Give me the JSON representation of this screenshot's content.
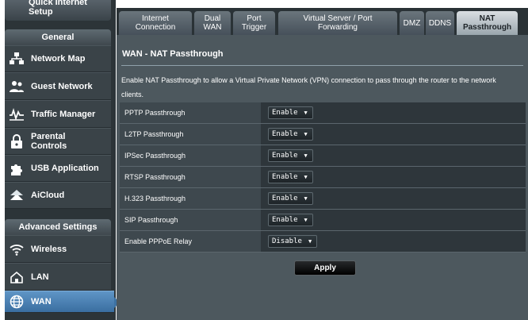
{
  "sidebar": {
    "quick_setup": "Quick Internet Setup",
    "general_header": "General",
    "general_items": [
      {
        "label": "Network Map",
        "icon": "network-map-icon"
      },
      {
        "label": "Guest Network",
        "icon": "guest-network-icon"
      },
      {
        "label": "Traffic Manager",
        "icon": "traffic-manager-icon"
      },
      {
        "label": "Parental Controls",
        "icon": "parental-controls-icon"
      },
      {
        "label": "USB Application",
        "icon": "usb-application-icon"
      },
      {
        "label": "AiCloud",
        "icon": "aicloud-icon"
      }
    ],
    "advanced_header": "Advanced Settings",
    "advanced_items": [
      {
        "label": "Wireless",
        "icon": "wireless-icon"
      },
      {
        "label": "LAN",
        "icon": "lan-icon"
      },
      {
        "label": "WAN",
        "icon": "wan-icon",
        "active": true
      }
    ]
  },
  "tabs": [
    {
      "label": "Internet\nConnection"
    },
    {
      "label": "Dual\nWAN"
    },
    {
      "label": "Port\nTrigger"
    },
    {
      "label": "Virtual Server / Port\nForwarding"
    },
    {
      "label": "DMZ"
    },
    {
      "label": "DDNS"
    },
    {
      "label": "NAT\nPassthrough",
      "active": true
    }
  ],
  "panel": {
    "title": "WAN - NAT Passthrough",
    "description": "Enable NAT Passthrough to allow a Virtual Private Network (VPN) connection to pass through the router to the network clients."
  },
  "settings": [
    {
      "label": "PPTP Passthrough",
      "value": "Enable"
    },
    {
      "label": "L2TP Passthrough",
      "value": "Enable"
    },
    {
      "label": "IPSec Passthrough",
      "value": "Enable"
    },
    {
      "label": "RTSP Passthrough",
      "value": "Enable"
    },
    {
      "label": "H.323 Passthrough",
      "value": "Enable"
    },
    {
      "label": "SIP Passthrough",
      "value": "Enable"
    },
    {
      "label": "Enable PPPoE Relay",
      "value": "Disable"
    }
  ],
  "apply_label": "Apply",
  "colors": {
    "active_nav": "#4a83b8",
    "panel_bg": "#4d585e",
    "sidebar_bg": "#2c3438"
  }
}
